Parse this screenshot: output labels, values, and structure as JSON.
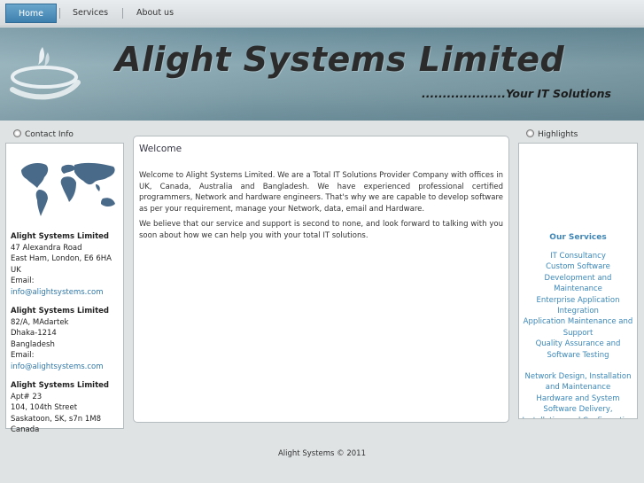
{
  "nav": {
    "home": "Home",
    "services": "Services",
    "about": "About us"
  },
  "banner": {
    "title": "Alight Systems Limited",
    "tagline": "....................Your IT Solutions"
  },
  "contact": {
    "heading": "Contact Info",
    "offices": [
      {
        "name": "Alight Systems Limited",
        "lines": [
          "47 Alexandra Road",
          "East Ham, London, E6 6HA",
          "UK"
        ],
        "email_label": "Email: ",
        "email": "info@alightsystems.com"
      },
      {
        "name": "Alight Systems Limited",
        "lines": [
          "82/A, MAdartek",
          "Dhaka-1214",
          "Bangladesh"
        ],
        "email_label": "Email: ",
        "email": "info@alightsystems.com"
      },
      {
        "name": "Alight Systems Limited",
        "lines": [
          "Apt# 23",
          "104, 104th Street",
          "Saskatoon, SK, s7n 1M8",
          "Canada"
        ]
      }
    ]
  },
  "welcome": {
    "title": "Welcome",
    "p1": "Welcome to Alight Systems Limited. We are a Total IT Solutions Provider Company with offices in UK, Canada, Australia and Bangladesh. We have experienced professional certified programmers, Network and hardware engineers. That's why we are capable to develop software as per your requirement, manage your Network, data, email and Hardware.",
    "p2": "We believe that our service and support is second to none, and look forward to talking with you soon about how we can help you with your total IT solutions."
  },
  "highlights": {
    "heading": "Highlights",
    "services_title": "Our Services",
    "group1": [
      "IT Consultancy",
      "Custom Software Development and Maintenance",
      "Enterprise Application Integration",
      "Application Maintenance and Support",
      "Quality Assurance and Software Testing"
    ],
    "group2": [
      "Network Design, Installation and Maintenance",
      "Hardware and System",
      "Software Delivery, Installation and Configuration"
    ]
  },
  "footer": {
    "text": "Alight Systems © 2011"
  }
}
